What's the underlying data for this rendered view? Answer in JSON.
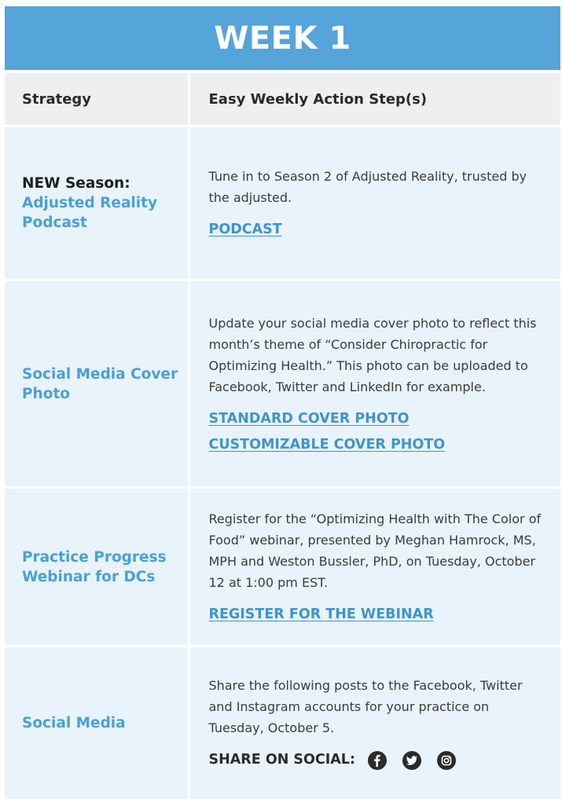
{
  "banner": {
    "title": "WEEK 1"
  },
  "header": {
    "strategy": "Strategy",
    "action": "Easy Weekly Action Step(s)"
  },
  "rows": [
    {
      "strategy_prefix": "NEW Season:",
      "strategy": "Adjusted Reality Podcast",
      "text": "Tune in to Season 2 of Adjusted Reality, trusted by the adjusted.",
      "links": [
        "PODCAST"
      ]
    },
    {
      "strategy": "Social Media Cover Photo",
      "text": "Update your social media cover photo to reflect this month’s theme of “Consider Chiropractic for Optimizing Health.” This photo can be uploaded to Facebook, Twitter and LinkedIn for example.",
      "links": [
        "STANDARD COVER PHOTO",
        "CUSTOMIZABLE COVER PHOTO"
      ]
    },
    {
      "strategy": "Practice Progress Webinar for DCs",
      "text": "Register for the “Optimizing Health with The Color of Food” webinar, presented by Meghan Hamrock, MS, MPH and Weston Bussler, PhD, on Tuesday, October 12 at 1:00 pm EST.",
      "links": [
        "REGISTER FOR THE WEBINAR"
      ]
    },
    {
      "strategy": "Social Media",
      "text": "Share the following posts to the Facebook, Twitter and Instagram accounts for your practice on Tuesday, October 5.",
      "share_label": "SHARE ON SOCIAL:",
      "share_icons": [
        "facebook-icon",
        "twitter-icon",
        "instagram-icon"
      ]
    }
  ],
  "colors": {
    "banner": "#55a4da",
    "header_bg": "#efefef",
    "row_bg": "#e8f3fb",
    "accent": "#4aa0d8",
    "link": "#3f94cf"
  }
}
